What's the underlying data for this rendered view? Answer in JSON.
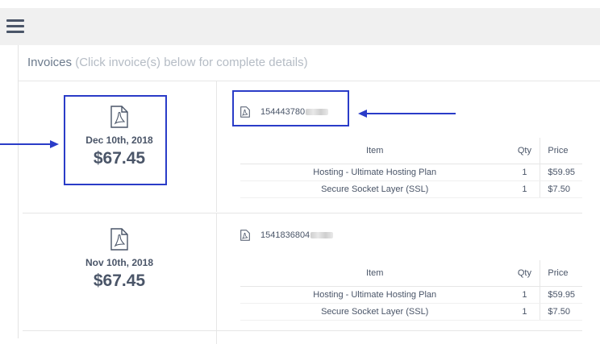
{
  "header": {
    "menu_icon": "hamburger-icon"
  },
  "panel": {
    "title": "Invoices",
    "hint": "(Click invoice(s) below for complete details)"
  },
  "invoices": [
    {
      "date": "Dec 10th, 2018",
      "amount": "$67.45",
      "number": "154443780",
      "table": {
        "headers": {
          "item": "Item",
          "qty": "Qty",
          "price": "Price"
        },
        "rows": [
          {
            "item": "Hosting - Ultimate Hosting Plan",
            "qty": "1",
            "price": "$59.95"
          },
          {
            "item": "Secure Socket Layer (SSL)",
            "qty": "1",
            "price": "$7.50"
          }
        ]
      }
    },
    {
      "date": "Nov 10th, 2018",
      "amount": "$67.45",
      "number": "1541836804",
      "table": {
        "headers": {
          "item": "Item",
          "qty": "Qty",
          "price": "Price"
        },
        "rows": [
          {
            "item": "Hosting - Ultimate Hosting Plan",
            "qty": "1",
            "price": "$59.95"
          },
          {
            "item": "Secure Socket Layer (SSL)",
            "qty": "1",
            "price": "$7.50"
          }
        ]
      }
    }
  ],
  "annotations": {
    "highlight_color": "#2a3cc8"
  },
  "icons": {
    "pdf": "pdf-file-icon"
  }
}
